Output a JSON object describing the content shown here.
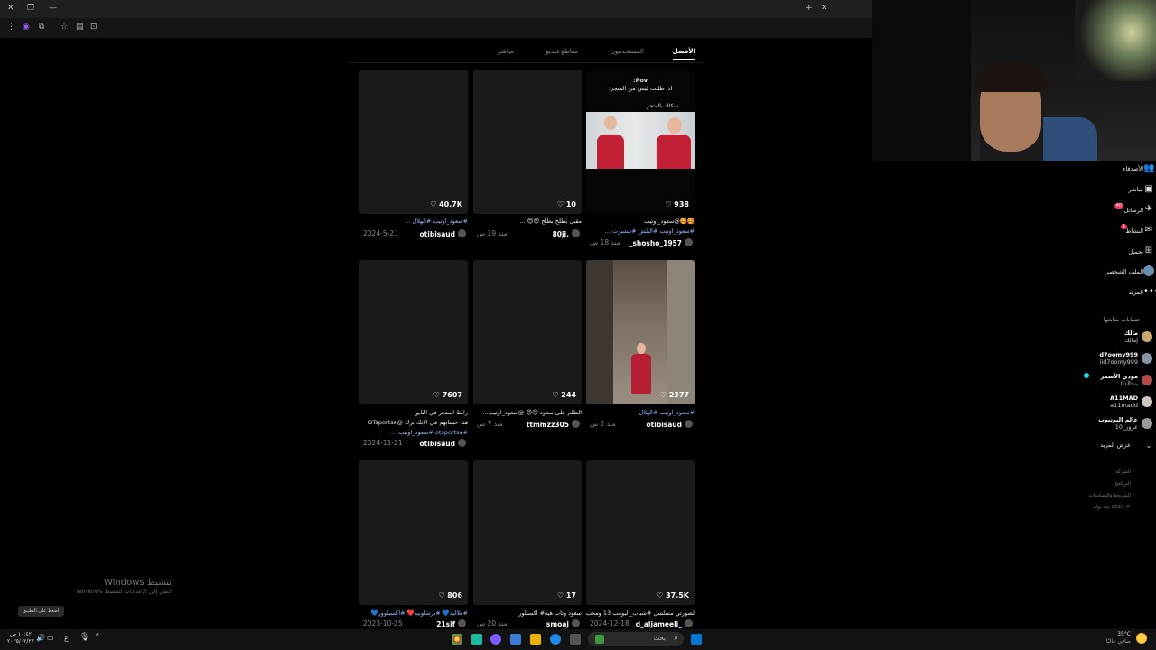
{
  "browser": {
    "url_icons": [
      "close-icon",
      "restore-icon",
      "minimize-icon",
      "new-tab-icon",
      "close-tab-icon"
    ]
  },
  "tabs": [
    {
      "label": "الأفضل",
      "active": true
    },
    {
      "label": "المستخدمون",
      "active": false
    },
    {
      "label": "مقاطع فيديو",
      "active": false
    },
    {
      "label": "مباشر",
      "active": false
    }
  ],
  "results": [
    {
      "likes": "938",
      "caption": [
        "🥰🥰@سعود_اوتيب",
        "#سعود_اوتيب #البلش #تيشيرت ..."
      ],
      "user": "_shosho_1957",
      "date": "منذ 18 س",
      "overlay": [
        "Pov:",
        "اذا طلبت ليس من المتجر:",
        "شكلك بالمتجر"
      ]
    },
    {
      "likes": "10",
      "caption": [
        "مقبل بطلج بطلج 😍😍 ..."
      ],
      "user": "80jj.",
      "date": "منذ 19 س"
    },
    {
      "likes": "40.7K",
      "caption": [
        "#سعود_اوتيب #الهلال ..."
      ],
      "user": "otibisaud",
      "date": "2024-5-21"
    },
    {
      "likes": "2377",
      "caption": [
        "#سعود_اوتيب #الهلال"
      ],
      "user": "otibisaud",
      "date": "منذ 2 س"
    },
    {
      "likes": "244",
      "caption": [
        "الظلم على سعود 😡😡 @سعود_اوتيب..."
      ],
      "user": "ttmmzz305",
      "date": "منذ 7 س"
    },
    {
      "likes": "7607",
      "caption": [
        "رابط المتجر في البايو",
        "هذا حسابهم في الابك ترك @OTsportsa",
        "#otsportsa #سعود_اوتيب ..."
      ],
      "user": "otibisaud",
      "date": "2024-11-21"
    },
    {
      "likes": "37.5K",
      "caption": [
        "لصورتي مسلسل #شباب_البومب 13 ومحب..."
      ],
      "user": "d_aljameeli_",
      "date": "2024-12-18"
    },
    {
      "likes": "17",
      "caption": [
        "سعود وتاب هيه# اكسبلور"
      ],
      "user": "smoaj",
      "date": "منذ 20 س"
    },
    {
      "likes": "806",
      "caption": [
        "#هلاليه💙 #برشلونيه❤️ #اكسبلوور💙"
      ],
      "user": "21sif",
      "date": "2023-10-25"
    }
  ],
  "sidebar": {
    "nav": [
      {
        "label": "الأصدقاء",
        "icon": "friends-icon"
      },
      {
        "label": "مباشر",
        "icon": "live-icon"
      },
      {
        "label": "الرسائل",
        "icon": "messages-icon",
        "badge": "40"
      },
      {
        "label": "النشاط",
        "icon": "activity-icon",
        "badge": "1"
      },
      {
        "label": "تحميل",
        "icon": "upload-icon"
      },
      {
        "label": "الملف الشخصي",
        "icon": "profile-icon"
      },
      {
        "label": "المزيد",
        "icon": "more-icon"
      }
    ],
    "following_title": "حسابات متابعها",
    "accounts": [
      {
        "name": "مالك",
        "handle": "إمالك"
      },
      {
        "name": "d7oomy999",
        "handle": "iid7oomy999"
      },
      {
        "name": "مودي الأسمر",
        "handle": "بنخالد0"
      },
      {
        "name": "A11MAD",
        "handle": "a11madd"
      },
      {
        "name": "عالم اليوتيوب",
        "handle": "عزوز_10"
      }
    ],
    "see_more": "عرض المزيد",
    "footer": [
      "الشركة",
      "البرنامج",
      "الشروط والسياسات",
      "© 2025 تيك توك"
    ]
  },
  "watermark": {
    "title": "تنشيط Windows",
    "subtitle": "انتقل إلى الإعدادات لتنشيط Windows"
  },
  "tooltip": "اضغط على التطبيق",
  "taskbar": {
    "time": "١٠:٤٢ ص",
    "date": "٢٠٢٥/٠٢/٢٧",
    "search": "بحث",
    "weather": "35°C",
    "weather_desc": "صافي غالبًا",
    "lang": "ع"
  }
}
